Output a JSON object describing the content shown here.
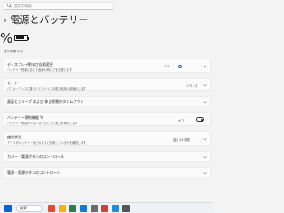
{
  "search": {
    "placeholder": "設定の検索"
  },
  "header": {
    "crumb": "›",
    "title": "電源とバッテリー"
  },
  "battery": {
    "percent_label": "%",
    "level_percent": 80,
    "estimate": "残り時間 2 分"
  },
  "sections": {
    "brightness": {
      "title": "ディスプレイ明るさ自動変更",
      "sub": "バッテリー残量に応じて画面の明るさを変更します",
      "value": "1/7",
      "level_fraction": 0.14
    },
    "mode": {
      "title": "モード",
      "sub": "パフォーマンスに基づいてデバイスの電力使用を最適化します",
      "value": "バランス"
    },
    "sleep": {
      "title": "画面とスリープ および 休止状態のタイムアウト"
    },
    "saver": {
      "title": "バッテリー節約機能 %",
      "sub": "バッテリー残量が少なくなったときに電力を節約します",
      "toggle_label": "オフ",
      "toggle_on": true
    },
    "battery_usage": {
      "title": "使用状況",
      "sub": "アプリがバッテリーをどのように使用しているかを確認します",
      "value": "過去 24 時間"
    },
    "lid": {
      "title": "カバー・電源ボタンのコントロール"
    },
    "power": {
      "title": "電源・電源ボタンのコントロール"
    }
  },
  "taskbar": {
    "search_label": "検索"
  },
  "colors": {
    "accent": "#0067c0",
    "background": "#f3f3f3",
    "card": "#fbfbfb"
  }
}
